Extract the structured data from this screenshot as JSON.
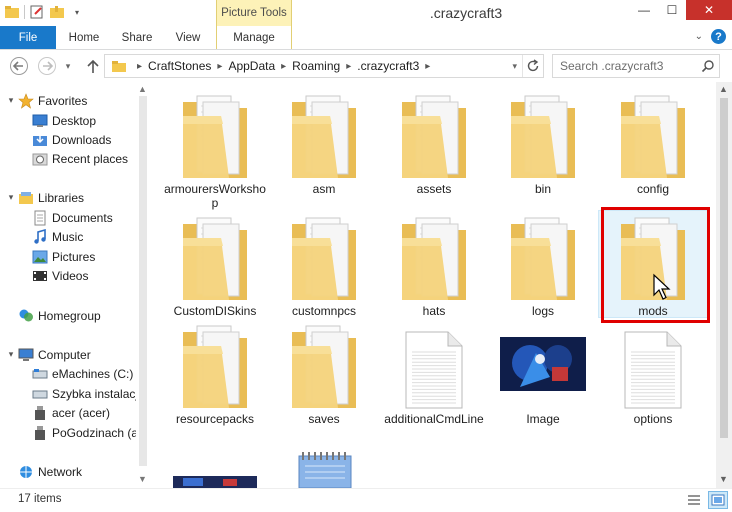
{
  "window": {
    "title": ".crazycraft3",
    "contextual_tab": "Picture Tools"
  },
  "ribbon": {
    "tabs": [
      "File",
      "Home",
      "Share",
      "View",
      "Manage"
    ]
  },
  "address": {
    "crumbs": [
      "CraftStones",
      "AppData",
      "Roaming",
      ".crazycraft3"
    ],
    "search_placeholder": "Search .crazycraft3"
  },
  "nav": {
    "favorites": "Favorites",
    "desktop": "Desktop",
    "downloads": "Downloads",
    "recent": "Recent places",
    "libraries": "Libraries",
    "documents": "Documents",
    "music": "Music",
    "pictures": "Pictures",
    "videos": "Videos",
    "homegroup": "Homegroup",
    "computer": "Computer",
    "drive_c": "eMachines (C:)",
    "drive_szybka": "Szybka instalacja",
    "drive_acer": "acer (acer)",
    "drive_po": "PoGodzinach (ac",
    "network": "Network"
  },
  "items": [
    {
      "label": "armourersWorkshop",
      "type": "folder"
    },
    {
      "label": "asm",
      "type": "folder"
    },
    {
      "label": "assets",
      "type": "folder"
    },
    {
      "label": "bin",
      "type": "folder"
    },
    {
      "label": "config",
      "type": "folder"
    },
    {
      "label": "CustomDISkins",
      "type": "folder"
    },
    {
      "label": "customnpcs",
      "type": "folder"
    },
    {
      "label": "hats",
      "type": "folder"
    },
    {
      "label": "logs",
      "type": "folder"
    },
    {
      "label": "mods",
      "type": "folder",
      "selected": true
    },
    {
      "label": "resourcepacks",
      "type": "folder"
    },
    {
      "label": "saves",
      "type": "folder"
    },
    {
      "label": "additionalCmdLine",
      "type": "file"
    },
    {
      "label": "Image",
      "type": "image"
    },
    {
      "label": "options",
      "type": "file"
    }
  ],
  "status": {
    "count": "17 items"
  },
  "colors": {
    "accent": "#1979ca",
    "folder": "#f3d27a",
    "highlight": "#e00000",
    "close": "#c7312b"
  }
}
